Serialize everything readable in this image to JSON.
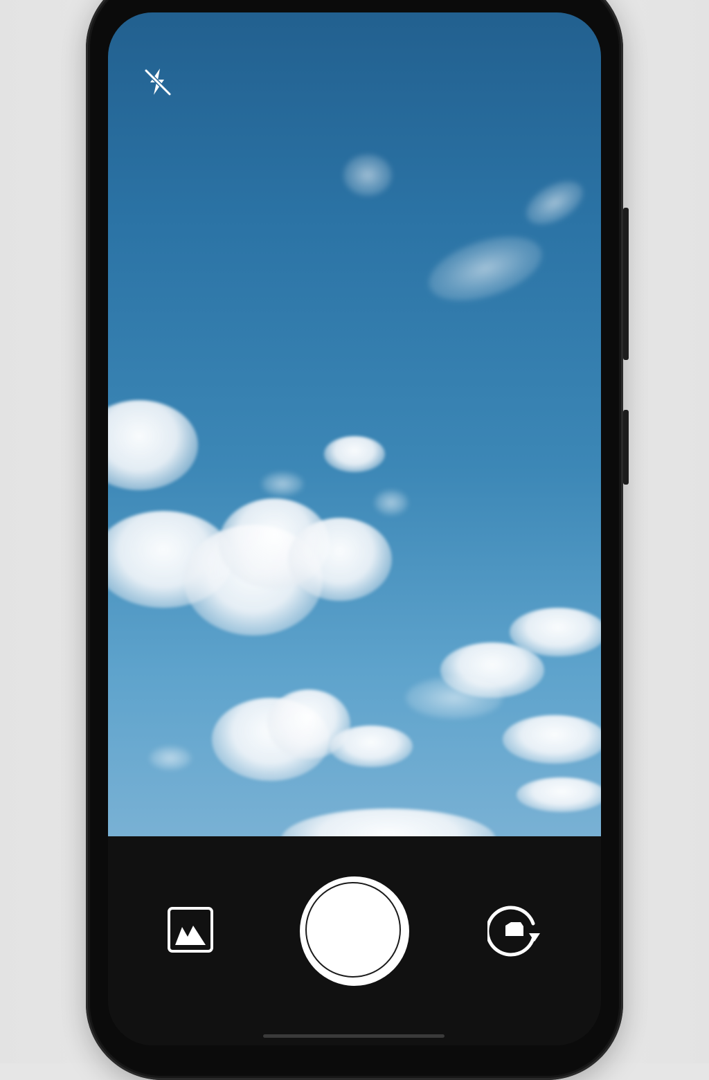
{
  "app": {
    "screen": "camera-viewfinder"
  },
  "top_controls": {
    "flash": {
      "icon": "flash-off-icon",
      "state": "off"
    }
  },
  "viewfinder": {
    "scene": "sky-with-clouds"
  },
  "bottom_controls": {
    "gallery": {
      "icon": "gallery-thumbnail-icon"
    },
    "shutter": {
      "icon": "shutter-button"
    },
    "flip": {
      "icon": "camera-flip-icon"
    }
  },
  "colors": {
    "sky_top": "#22608f",
    "sky_bottom": "#79b1d4",
    "control_bar": "#111111",
    "icon": "#ffffff"
  }
}
